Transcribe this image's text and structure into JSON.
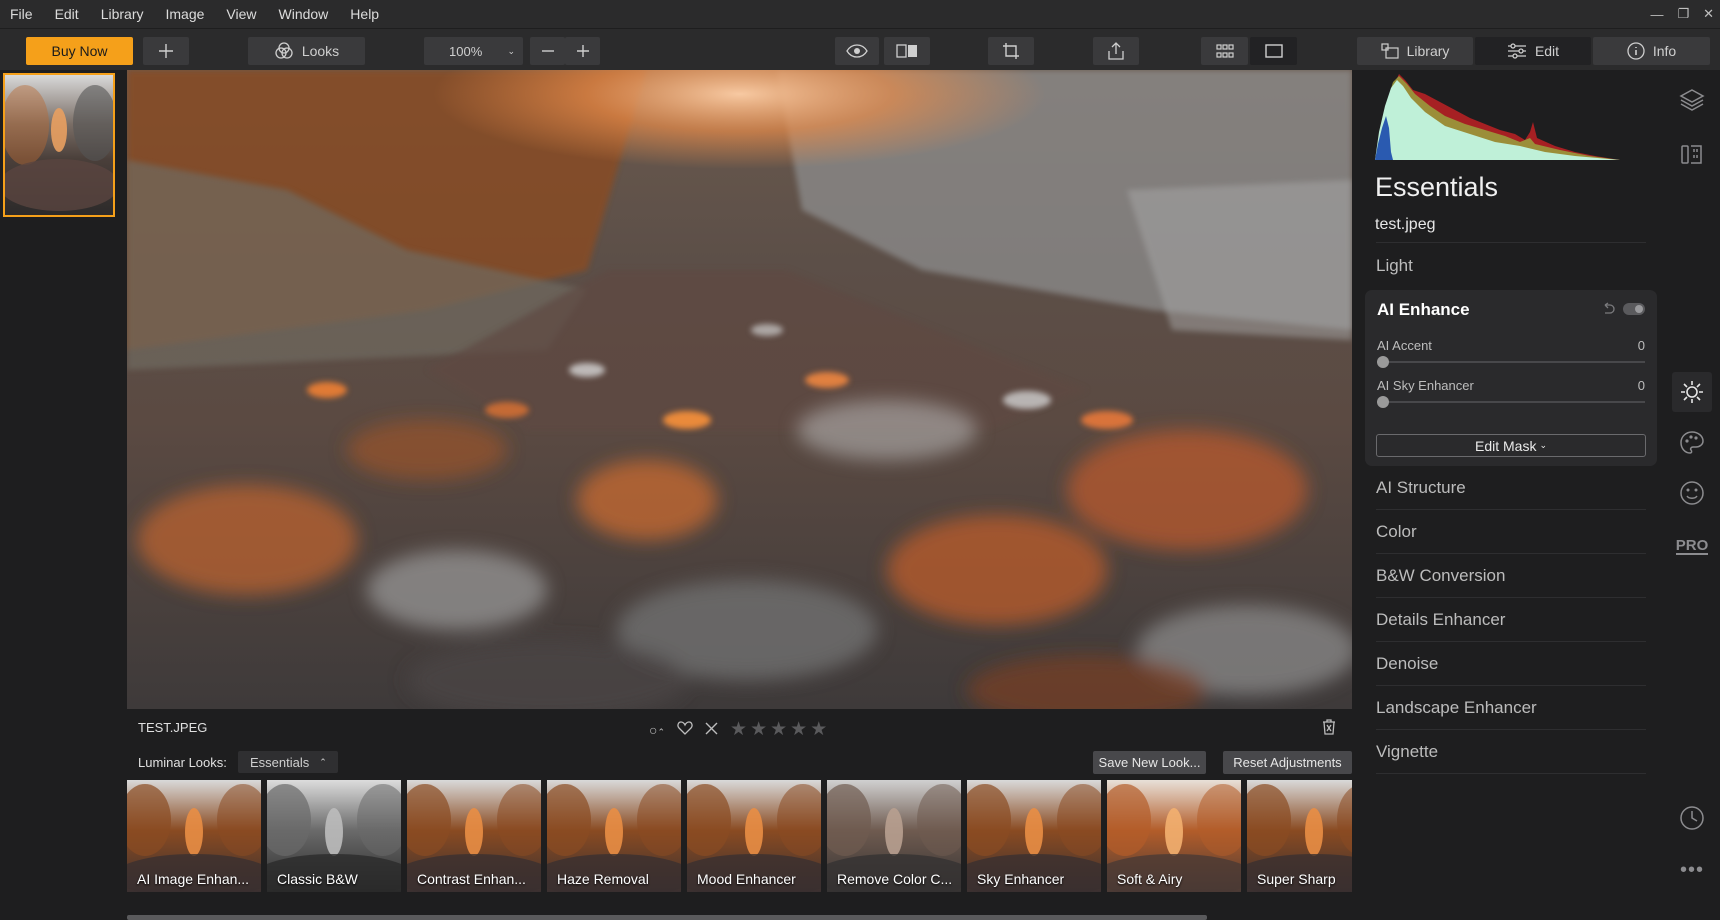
{
  "menu": [
    "File",
    "Edit",
    "Library",
    "Image",
    "View",
    "Window",
    "Help"
  ],
  "toolbar": {
    "buy_label": "Buy Now",
    "looks_label": "Looks",
    "zoom_value": "100%",
    "tabs": [
      {
        "label": "Library",
        "icon": "library-icon"
      },
      {
        "label": "Edit",
        "icon": "sliders-icon"
      },
      {
        "label": "Info",
        "icon": "info-icon"
      }
    ]
  },
  "image": {
    "filename": "TEST.JPEG"
  },
  "looks": {
    "label": "Luminar Looks:",
    "selected": "Essentials",
    "save_label": "Save New Look...",
    "reset_label": "Reset Adjustments",
    "items": [
      {
        "name": "AI Image Enhan...",
        "tone": "color"
      },
      {
        "name": "Classic B&W",
        "tone": "bw"
      },
      {
        "name": "Contrast Enhan...",
        "tone": "color"
      },
      {
        "name": "Haze Removal",
        "tone": "color"
      },
      {
        "name": "Mood Enhancer",
        "tone": "color"
      },
      {
        "name": "Remove Color C...",
        "tone": "muted"
      },
      {
        "name": "Sky Enhancer",
        "tone": "color"
      },
      {
        "name": "Soft & Airy",
        "tone": "warm"
      },
      {
        "name": "Super Sharp",
        "tone": "color"
      }
    ]
  },
  "panel": {
    "title": "Essentials",
    "file": "test.jpeg",
    "sections_before": [
      "Light"
    ],
    "ai_enhance": {
      "title": "AI Enhance",
      "sliders": [
        {
          "label": "AI Accent",
          "value": "0"
        },
        {
          "label": "AI Sky Enhancer",
          "value": "0"
        }
      ],
      "mask_label": "Edit Mask"
    },
    "sections_after": [
      "AI Structure",
      "Color",
      "B&W Conversion",
      "Details Enhancer",
      "Denoise",
      "Landscape Enhancer",
      "Vignette"
    ]
  },
  "tools": {
    "pro_label": "PRO"
  },
  "colors": {
    "accent": "#f5a01a",
    "background": "#1e1e1f",
    "panel": "#2b2b2c"
  }
}
